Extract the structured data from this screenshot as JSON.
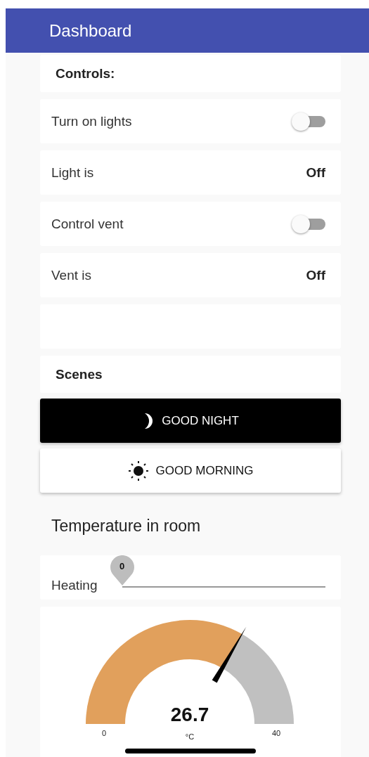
{
  "app_bar": {
    "title": "Dashboard"
  },
  "controls": {
    "title": "Controls:",
    "items": [
      {
        "kind": "toggle",
        "label": "Turn on lights",
        "on": false
      },
      {
        "kind": "status",
        "label": "Light is",
        "value": "Off"
      },
      {
        "kind": "toggle",
        "label": "Control vent",
        "on": false
      },
      {
        "kind": "status",
        "label": "Vent is",
        "value": "Off"
      },
      {
        "kind": "empty"
      }
    ]
  },
  "scenes": {
    "title": "Scenes",
    "buttons": [
      {
        "kind": "moon",
        "label": "GOOD NIGHT",
        "selected": true
      },
      {
        "kind": "sun",
        "label": "GOOD MORNING",
        "selected": false
      }
    ]
  },
  "temperature": {
    "title": "Temperature in room",
    "heating": {
      "label": "Heating",
      "value": "0",
      "level": 0
    },
    "gauge": {
      "value": "26.7",
      "unit": "°C",
      "min": "0",
      "max": "40"
    }
  }
}
